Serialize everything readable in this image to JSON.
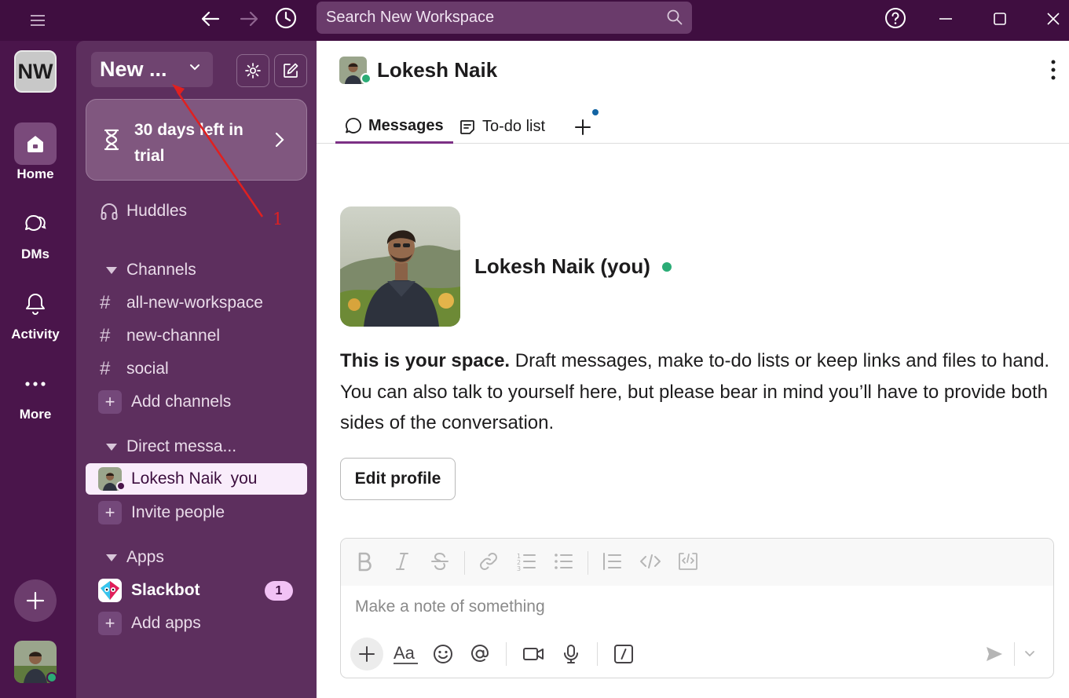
{
  "search": {
    "placeholder": "Search New Workspace"
  },
  "rail": {
    "workspace_initials": "NW",
    "items": [
      {
        "label": "Home"
      },
      {
        "label": "DMs"
      },
      {
        "label": "Activity"
      },
      {
        "label": "More"
      }
    ]
  },
  "sidebar": {
    "workspace_name": "New ...",
    "trial_text": "30 days left in trial",
    "huddles": "Huddles",
    "channels_header": "Channels",
    "channels": [
      {
        "name": "all-new-workspace"
      },
      {
        "name": "new-channel"
      },
      {
        "name": "social"
      }
    ],
    "add_channels": "Add channels",
    "dm_header": "Direct messa...",
    "dm_user": "Lokesh Naik",
    "dm_you": "you",
    "invite": "Invite people",
    "apps_header": "Apps",
    "slackbot": "Slackbot",
    "slackbot_badge": "1",
    "add_apps": "Add apps"
  },
  "main": {
    "title": "Lokesh Naik",
    "tabs": [
      {
        "label": "Messages"
      },
      {
        "label": "To-do list"
      }
    ],
    "profile_name": "Lokesh Naik (you)",
    "intro_bold": "This is your space.",
    "intro_text": " Draft messages, make to-do lists or keep links and files to hand. You can also talk to yourself here, but please bear in mind you’ll have to provide both sides of the conversation.",
    "edit_profile": "Edit profile",
    "composer_placeholder": "Make a note of something"
  },
  "annotation": {
    "number": "1"
  },
  "colors": {
    "rail_bg": "#4a154b",
    "sidebar_bg": "#5d2f5e",
    "presence": "#2bac76",
    "annotation": "#e02020"
  }
}
